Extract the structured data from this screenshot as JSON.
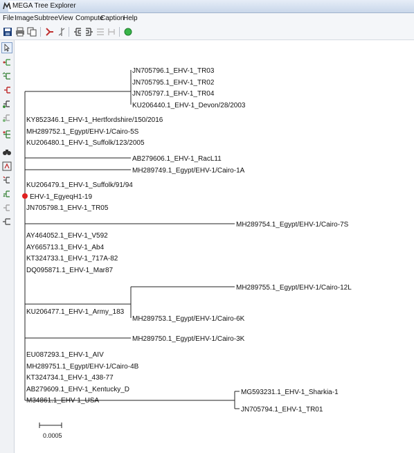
{
  "window": {
    "title": "MEGA Tree Explorer"
  },
  "menu": [
    "File",
    "Image",
    "Subtree",
    "View",
    "Compute",
    "Caption",
    "Help"
  ],
  "toolbar": {
    "icons": [
      "save-icon",
      "print-icon",
      "copy-icon",
      "tree-style-icon",
      "branch-icon",
      "root-icon",
      "flip-icon",
      "compress-icon",
      "toggle-icon",
      "green-status-icon"
    ]
  },
  "sidebar": {
    "icons": [
      "pointer-icon",
      "root-on-branch-icon",
      "flip-subtree-icon",
      "compress-subtree-icon",
      "swap-icon",
      "subtree-style-icon",
      "expand-icon",
      "search-icon",
      "info-icon",
      "caption-icon",
      "marker-icon",
      "topology-icon",
      "tree-icon"
    ]
  },
  "tree": {
    "groups": [
      [
        "JN705796.1_EHV-1_TR03",
        "JN705795.1_EHV-1_TR02",
        "JN705797.1_EHV-1_TR04",
        "KU206440.1_EHV-1_Devon/28/2003"
      ],
      [
        "KY852346.1_EHV-1_Hertfordshire/150/2016",
        "MH289752.1_Egypt/EHV-1/Cairo-5S",
        "KU206480.1_EHV-1_Suffolk/123/2005"
      ],
      [
        "AB279606.1_EHV-1_RacL11"
      ],
      [
        "MH289749.1_Egypt/EHV-1/Cairo-1A"
      ],
      [
        "KU206479.1_EHV-1_Suffolk/91/94",
        "EHV-1_EgyeqH1-19",
        "JN705798.1_EHV-1_TR05"
      ],
      [
        "MH289754.1_Egypt/EHV-1/Cairo-7S"
      ],
      [
        "AY464052.1_EHV-1_V592",
        "AY665713.1_EHV-1_Ab4",
        "KT324733.1_EHV-1_717A-82",
        "DQ095871.1_EHV-1_Mar87"
      ],
      [
        "MH289755.1_Egypt/EHV-1/Cairo-12L"
      ],
      [
        "MH289753.1_Egypt/EHV-1/Cairo-6K"
      ],
      [
        "KU206477.1_EHV-1_Army_183"
      ],
      [
        "MH289750.1_Egypt/EHV-1/Cairo-3K"
      ],
      [
        "EU087293.1_EHV-1_AIV",
        "MH289751.1_Egypt/EHV-1/Cairo-4B",
        "KT324734.1_EHV-1_438-77",
        "AB279609.1_EHV-1_Kentucky_D",
        "M34861.1_EHV-1_USA"
      ],
      [
        "MG593231.1_EHV-1_Sharkia-1",
        "JN705794.1_EHV-1_TR01"
      ]
    ],
    "highlighted_taxon": "EHV-1_EgyeqH1-19",
    "highlight_color": "#e02020",
    "scale_bar_label": "0.0005"
  }
}
